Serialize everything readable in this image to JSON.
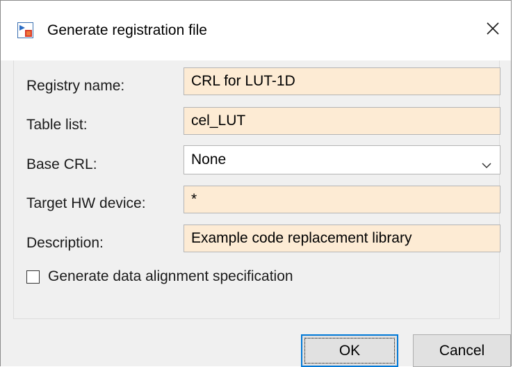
{
  "window": {
    "title": "Generate registration file",
    "icon": "simulink-app-icon",
    "close_icon": "close-icon"
  },
  "form": {
    "registry_name": {
      "label": "Registry name:",
      "value": "CRL for LUT-1D"
    },
    "table_list": {
      "label": "Table list:",
      "value": "cel_LUT"
    },
    "base_crl": {
      "label": "Base CRL:",
      "selected": "None"
    },
    "target_hw_device": {
      "label": "Target HW device:",
      "value": "*"
    },
    "description": {
      "label": "Description:",
      "value": "Example code replacement library"
    },
    "alignment_checkbox": {
      "label": "Generate data alignment specification",
      "checked": false
    }
  },
  "buttons": {
    "ok_label": "OK",
    "cancel_label": "Cancel"
  },
  "colors": {
    "field_background": "#fdebd4",
    "dialog_background": "#f0f0f0",
    "focus_border": "#0078d7"
  }
}
